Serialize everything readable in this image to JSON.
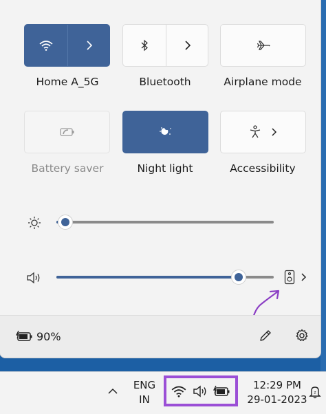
{
  "tiles": [
    {
      "label": "Home A_5G",
      "state": "on",
      "icon": "wifi-icon",
      "has_chevron": true
    },
    {
      "label": "Bluetooth",
      "state": "off",
      "icon": "bluetooth-icon",
      "has_chevron": true
    },
    {
      "label": "Airplane mode",
      "state": "off",
      "icon": "airplane-icon",
      "has_chevron": false
    },
    {
      "label": "Battery saver",
      "state": "disabled",
      "icon": "battery-saver-icon",
      "has_chevron": false
    },
    {
      "label": "Night light",
      "state": "on",
      "icon": "night-light-icon",
      "has_chevron": false
    },
    {
      "label": "Accessibility",
      "state": "off",
      "icon": "accessibility-icon",
      "has_chevron": true
    }
  ],
  "brightness": {
    "icon": "brightness-icon",
    "level": 0.04
  },
  "volume": {
    "icon": "speaker-icon",
    "level": 0.84,
    "output_icon": "audio-output-icon"
  },
  "footer": {
    "battery_icon": "battery-charging-icon",
    "battery_text": "90%",
    "edit_icon": "pencil-icon",
    "settings_icon": "gear-icon"
  },
  "taskbar": {
    "overflow_icon": "chevron-up-icon",
    "lang_line1": "ENG",
    "lang_line2": "IN",
    "tray_icons": [
      "wifi-icon",
      "speaker-icon",
      "battery-charging-icon"
    ],
    "time": "12:29 PM",
    "date": "29-01-2023",
    "notification_icon": "notification-bell-icon"
  },
  "colors": {
    "accent": "#3f6398",
    "highlight": "#9b4fd6"
  }
}
